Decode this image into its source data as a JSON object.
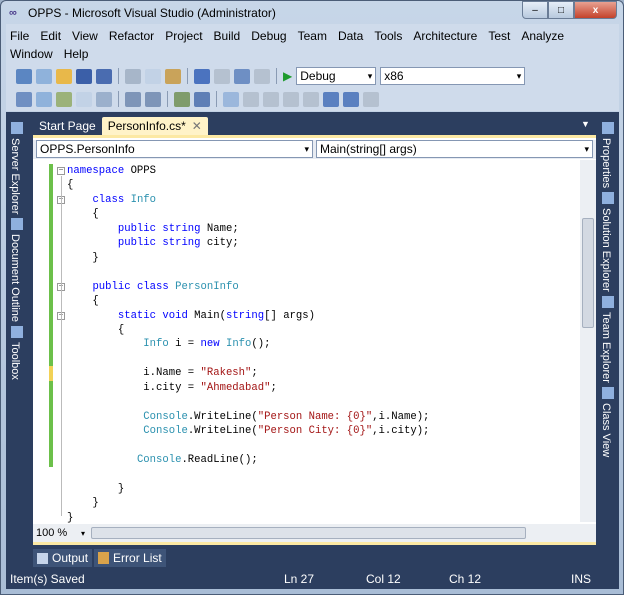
{
  "window": {
    "title": "OPPS - Microsoft Visual Studio (Administrator)",
    "minimize": "–",
    "maximize": "□",
    "close": "x"
  },
  "menu": [
    "File",
    "Edit",
    "View",
    "Refactor",
    "Project",
    "Build",
    "Debug",
    "Team",
    "Data",
    "Tools",
    "Architecture",
    "Test",
    "Analyze",
    "Window",
    "Help"
  ],
  "toolbar": {
    "configuration": "Debug",
    "platform": "x86"
  },
  "left_panels": [
    "Server Explorer",
    "Document Outline",
    "Toolbox"
  ],
  "right_panels": [
    "Properties",
    "Solution Explorer",
    "Team Explorer",
    "Class View"
  ],
  "tabs": [
    {
      "label": "Start Page"
    },
    {
      "label": "PersonInfo.cs*",
      "active": true,
      "close": "✕"
    }
  ],
  "nav": {
    "type": "OPPS.PersonInfo",
    "member": "Main(string[] args)"
  },
  "code": [
    [
      [
        "kw",
        "namespace"
      ],
      [
        "p",
        " OPPS"
      ]
    ],
    [
      [
        "p",
        "{"
      ]
    ],
    [
      [
        "p",
        "    "
      ],
      [
        "kw",
        "class"
      ],
      [
        "p",
        " "
      ],
      [
        "ty",
        "Info"
      ]
    ],
    [
      [
        "p",
        "    {"
      ]
    ],
    [
      [
        "p",
        "        "
      ],
      [
        "kw",
        "public"
      ],
      [
        "p",
        " "
      ],
      [
        "kw",
        "string"
      ],
      [
        "p",
        " Name;"
      ]
    ],
    [
      [
        "p",
        "        "
      ],
      [
        "kw",
        "public"
      ],
      [
        "p",
        " "
      ],
      [
        "kw",
        "string"
      ],
      [
        "p",
        " city;"
      ]
    ],
    [
      [
        "p",
        "    }"
      ]
    ],
    [],
    [
      [
        "p",
        "    "
      ],
      [
        "kw",
        "public"
      ],
      [
        "p",
        " "
      ],
      [
        "kw",
        "class"
      ],
      [
        "p",
        " "
      ],
      [
        "ty",
        "PersonInfo"
      ]
    ],
    [
      [
        "p",
        "    {"
      ]
    ],
    [
      [
        "p",
        "        "
      ],
      [
        "kw",
        "static"
      ],
      [
        "p",
        " "
      ],
      [
        "kw",
        "void"
      ],
      [
        "p",
        " Main("
      ],
      [
        "kw",
        "string"
      ],
      [
        "p",
        "[] args)"
      ]
    ],
    [
      [
        "p",
        "        {"
      ]
    ],
    [
      [
        "p",
        "            "
      ],
      [
        "ty",
        "Info"
      ],
      [
        "p",
        " i = "
      ],
      [
        "kw",
        "new"
      ],
      [
        "p",
        " "
      ],
      [
        "ty",
        "Info"
      ],
      [
        "p",
        "();"
      ]
    ],
    [],
    [
      [
        "p",
        "            i.Name = "
      ],
      [
        "st",
        "\"Rakesh\""
      ],
      [
        "p",
        ";"
      ]
    ],
    [
      [
        "p",
        "            i.city = "
      ],
      [
        "st",
        "\"Ahmedabad\""
      ],
      [
        "p",
        ";"
      ]
    ],
    [],
    [
      [
        "p",
        "            "
      ],
      [
        "ty",
        "Console"
      ],
      [
        "p",
        ".WriteLine("
      ],
      [
        "st",
        "\"Person Name: {0}\""
      ],
      [
        "p",
        ",i.Name);"
      ]
    ],
    [
      [
        "p",
        "            "
      ],
      [
        "ty",
        "Console"
      ],
      [
        "p",
        ".WriteLine("
      ],
      [
        "st",
        "\"Person City: {0}\""
      ],
      [
        "p",
        ",i.city);"
      ]
    ],
    [],
    [
      [
        "p",
        "           "
      ],
      [
        "ty",
        "Console"
      ],
      [
        "p",
        ".ReadLine();"
      ]
    ],
    [],
    [
      [
        "p",
        "        }"
      ]
    ],
    [
      [
        "p",
        "    }"
      ]
    ],
    [
      [
        "p",
        "}"
      ]
    ]
  ],
  "zoom": "100 %",
  "bottom_tabs": [
    "Output",
    "Error List"
  ],
  "status": {
    "message": "Item(s) Saved",
    "line": "Ln 27",
    "col": "Col 12",
    "ch": "Ch 12",
    "mode": "INS"
  }
}
